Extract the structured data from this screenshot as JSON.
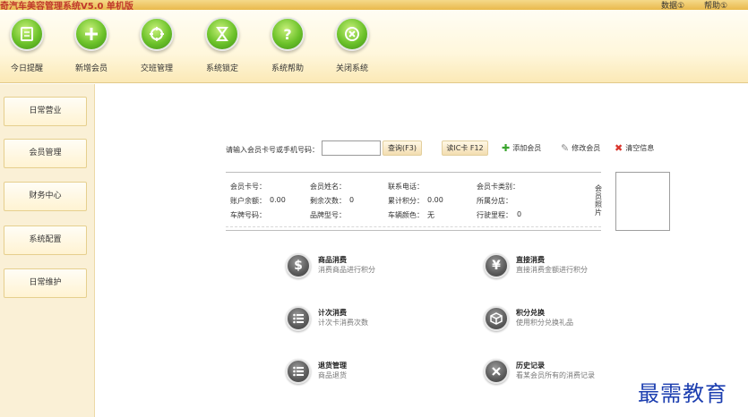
{
  "window": {
    "title": "奇汽车美容管理系统V5.0 单机版",
    "menu": [
      "数据①",
      "帮助①"
    ]
  },
  "toolbar": [
    {
      "label": "今日提醒",
      "icon": "reminder-icon"
    },
    {
      "label": "新增会员",
      "icon": "add-member-icon"
    },
    {
      "label": "交班管理",
      "icon": "shift-icon"
    },
    {
      "label": "系统锁定",
      "icon": "lock-icon"
    },
    {
      "label": "系统帮助",
      "icon": "help-icon"
    },
    {
      "label": "关闭系统",
      "icon": "close-icon"
    }
  ],
  "sidebar": {
    "items": [
      {
        "label": "日常营业"
      },
      {
        "label": "会员管理"
      },
      {
        "label": "财务中心"
      },
      {
        "label": "系统配置"
      },
      {
        "label": "日常维护"
      }
    ]
  },
  "search": {
    "label": "请输入会员卡号或手机号码：",
    "value": "",
    "query_button": "查询(F3)",
    "read_card_button": "读IC卡 F12",
    "add_member": "添加会员",
    "edit_member": "修改会员",
    "clear_info": "清空信息"
  },
  "member_info": {
    "card_no": "会员卡号：",
    "name": "会员姓名：",
    "phone": "联系电话：",
    "card_type": "会员卡类别：",
    "balance_label": "账户余额：",
    "balance_value": "0.00",
    "remaining_label": "剩余次数：",
    "remaining_value": "0",
    "points_label": "累计积分：",
    "points_value": "0.00",
    "branch": "所属分店：",
    "plate": "车牌号码：",
    "model": "品牌型号：",
    "color_label": "车辆颜色：",
    "color_value": "无",
    "mileage_label": "行驶里程：",
    "mileage_value": "0",
    "photo_label": "会员照片"
  },
  "functions": [
    {
      "name": "商品消费",
      "desc": "消费商品进行积分",
      "icon": "dollar-icon"
    },
    {
      "name": "直接消费",
      "desc": "直接消费金额进行积分",
      "icon": "yen-icon"
    },
    {
      "name": "计次消费",
      "desc": "计次卡消费次数",
      "icon": "list-icon"
    },
    {
      "name": "积分兑换",
      "desc": "使用积分兑换礼品",
      "icon": "box-icon"
    },
    {
      "name": "退货管理",
      "desc": "商品退货",
      "icon": "return-icon"
    },
    {
      "name": "历史记录",
      "desc": "看某会员所有的消费记录",
      "icon": "history-icon"
    }
  ],
  "watermark": "最需教育"
}
